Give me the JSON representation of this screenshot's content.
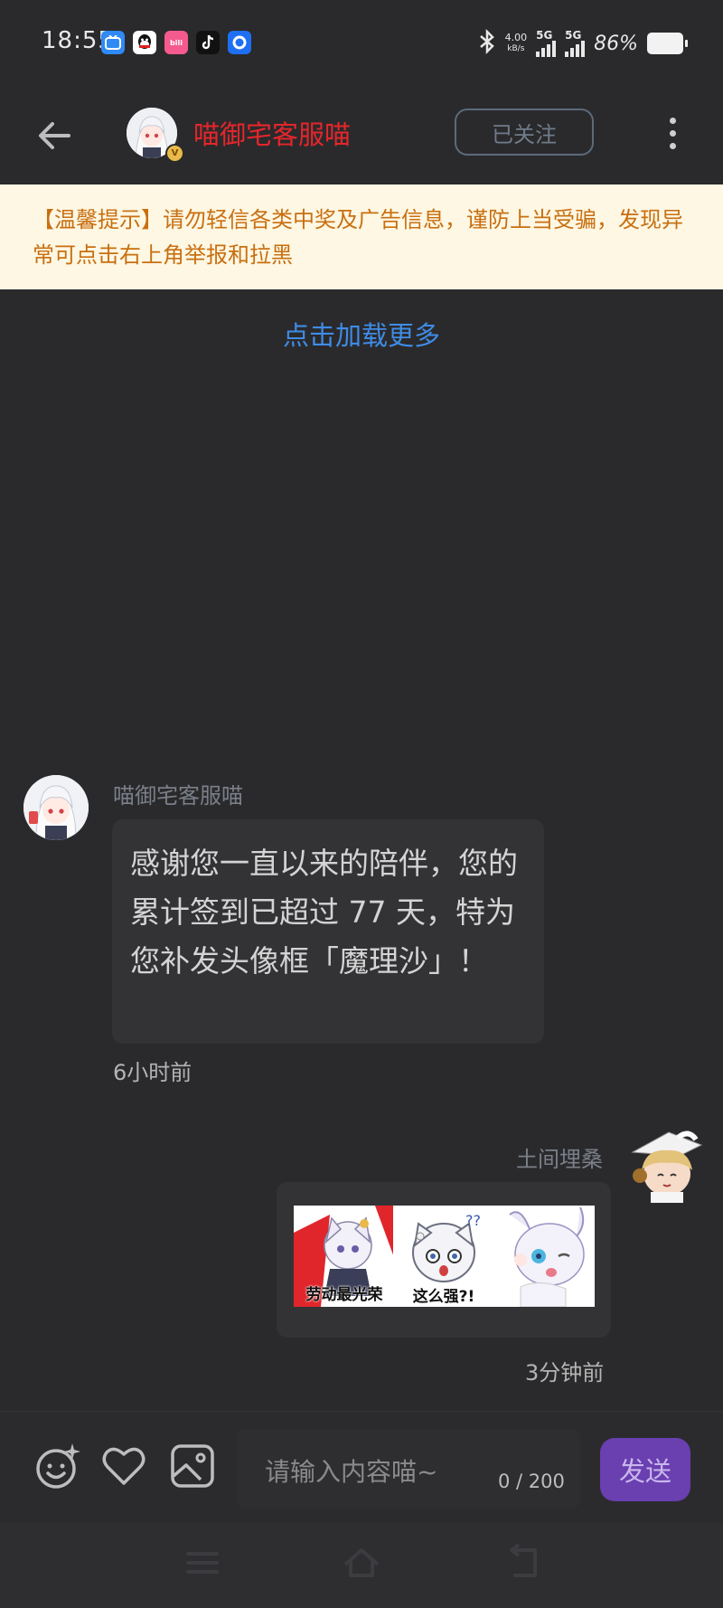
{
  "status_bar": {
    "time": "18:55",
    "net_speed": "4.00",
    "net_speed_unit": "kB/s",
    "signal1": "5G",
    "signal2": "5G",
    "battery": "86%",
    "app_icons": [
      "bilibili-tv-icon",
      "qq-icon",
      "bilibili-icon",
      "tiktok-icon",
      "browser-icon"
    ]
  },
  "header": {
    "title": "喵御宅客服喵",
    "follow_label": "已关注",
    "vip_badge": "V"
  },
  "notice": {
    "text": "【温馨提示】请勿轻信各类中奖及广告信息，谨防上当受骗，发现异常可点击右上角举报和拉黑"
  },
  "load_more": "点击加载更多",
  "messages": [
    {
      "sender": "喵御宅客服喵",
      "text": "感谢您一直以来的陪伴，您的累计签到已超过 77 天，特为您补发头像框「魔理沙」！",
      "time": "6小时前"
    },
    {
      "sender": "土间埋桑",
      "stickers": [
        {
          "caption": "劳动最光荣"
        },
        {
          "caption": "这么强?!"
        },
        {
          "caption": ""
        }
      ],
      "time": "3分钟前"
    }
  ],
  "input": {
    "placeholder": "请输入内容喵~",
    "count": "0 / 200",
    "send_label": "发送"
  },
  "colors": {
    "background": "#2a2a2c",
    "title_red": "#e5262b",
    "link_blue": "#3f8ce6",
    "notice_bg": "#fdf7e3",
    "notice_text": "#c96f10",
    "send_purple": "#6a3fb0"
  }
}
